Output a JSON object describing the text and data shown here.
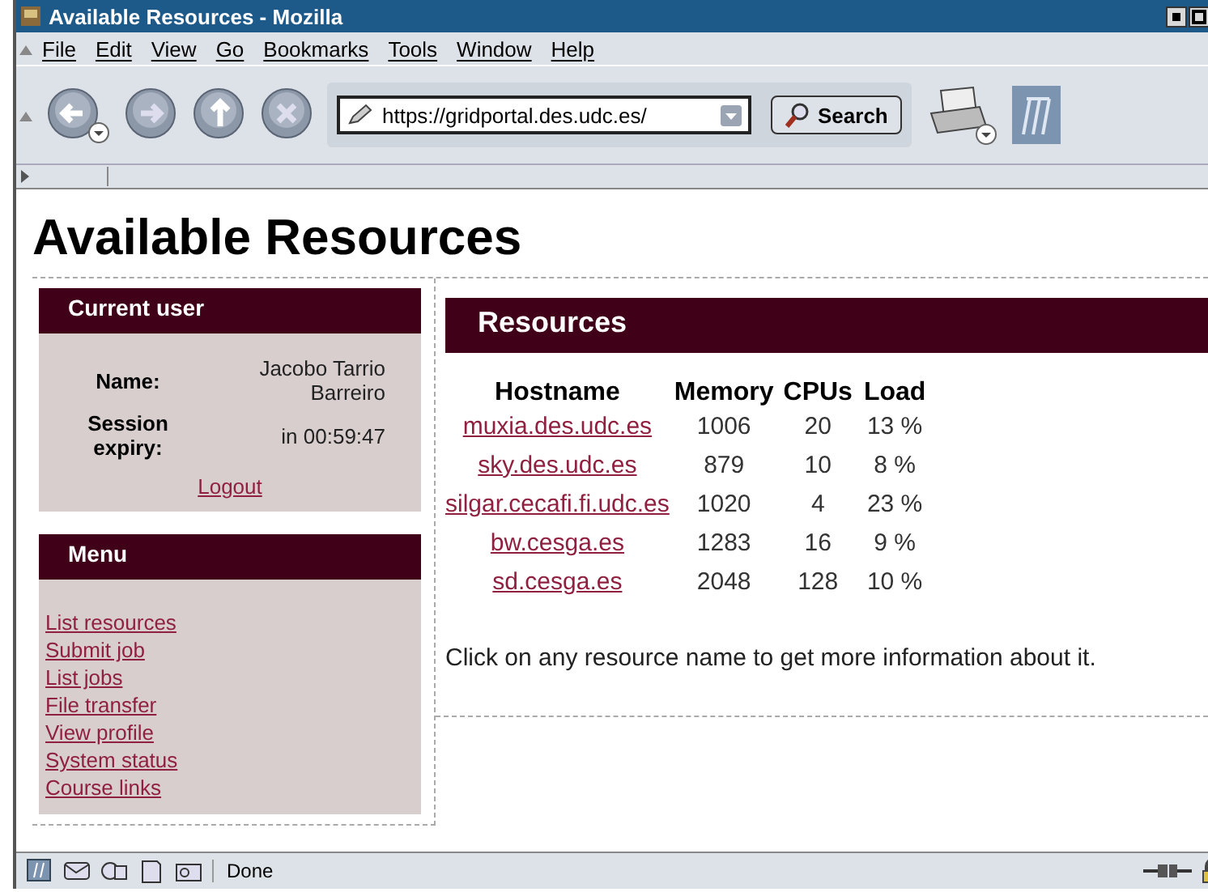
{
  "window": {
    "title": "Available Resources - Mozilla"
  },
  "menu": [
    "File",
    "Edit",
    "View",
    "Go",
    "Bookmarks",
    "Tools",
    "Window",
    "Help"
  ],
  "toolbar": {
    "url": "https://gridportal.des.udc.es/",
    "search_label": "Search"
  },
  "page": {
    "heading": "Available Resources",
    "current_user": {
      "title": "Current user",
      "fields": [
        {
          "label": "Name:",
          "value": "Jacobo Tarrio Barreiro"
        },
        {
          "label": "Session expiry:",
          "value": "in 00:59:47"
        }
      ],
      "logout": "Logout"
    },
    "menu_box": {
      "title": "Menu",
      "links": [
        "List resources",
        "Submit job",
        "List jobs",
        "File transfer",
        "View profile",
        "System status",
        "Course links"
      ]
    },
    "resources": {
      "title": "Resources",
      "columns": [
        "Hostname",
        "Memory",
        "CPUs",
        "Load"
      ],
      "rows": [
        [
          "muxia.des.udc.es",
          "1006",
          "20",
          "13 %"
        ],
        [
          "sky.des.udc.es",
          "879",
          "10",
          "8 %"
        ],
        [
          "silgar.cecafi.fi.udc.es",
          "1020",
          "4",
          "23 %"
        ],
        [
          "bw.cesga.es",
          "1283",
          "16",
          "9 %"
        ],
        [
          "sd.cesga.es",
          "2048",
          "128",
          "10 %"
        ]
      ],
      "note": "Click on any resource name to get more information about it."
    }
  },
  "status_bar": {
    "text": "Done"
  }
}
